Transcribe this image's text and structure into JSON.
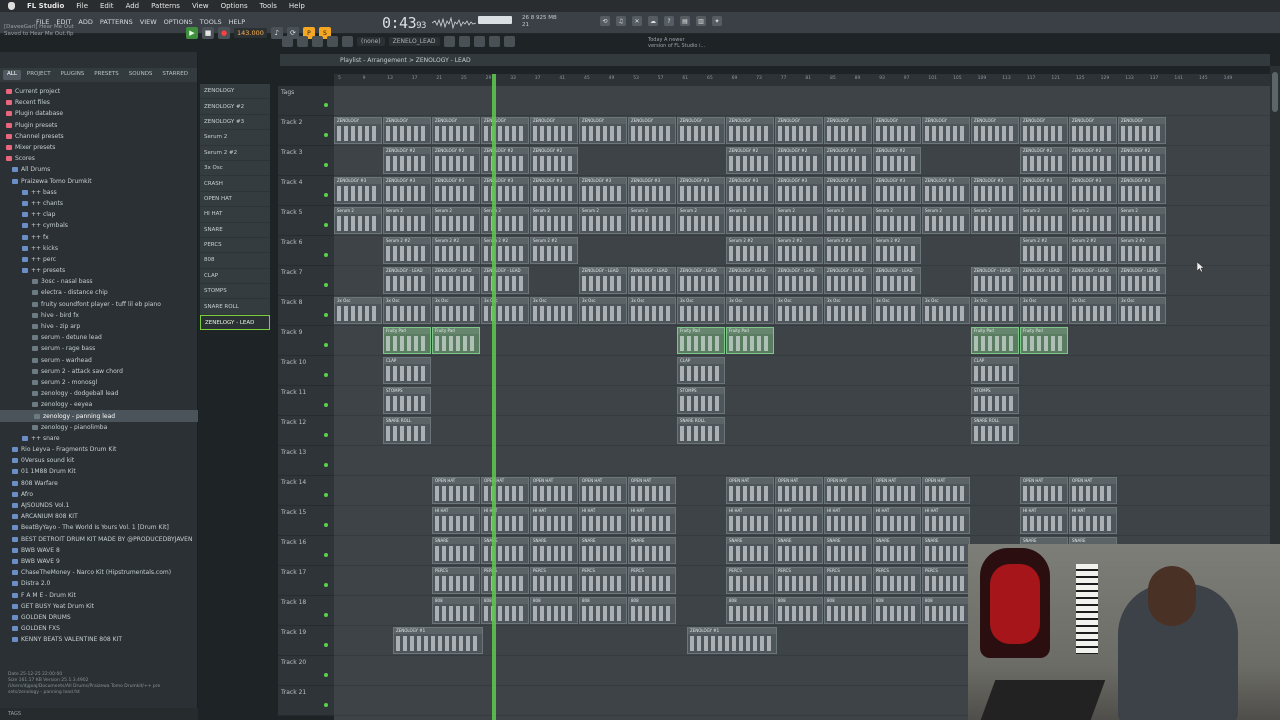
{
  "mac_menu": {
    "app": "FL Studio",
    "items": [
      "File",
      "Edit",
      "Add",
      "Patterns",
      "View",
      "Options",
      "Tools",
      "Help"
    ]
  },
  "fl_menu": [
    "FILE",
    "EDIT",
    "ADD",
    "PATTERNS",
    "VIEW",
    "OPTIONS",
    "TOOLS",
    "HELP"
  ],
  "song": {
    "line1": "[DaveeGarl] Hear Me Out",
    "line2": "Saved to Hear Me Out.flp"
  },
  "transport": {
    "bpm": "143.000",
    "time": "0:43",
    "time_small": "93",
    "cpu_line1": "26   8   925 MB",
    "cpu_line2": "      21"
  },
  "toolbar": {
    "snap": "(none)",
    "pattern": "ZENELO_LEAD"
  },
  "news": {
    "line1": "Today  A newer",
    "line2": "version of FL Studio i..."
  },
  "browser": {
    "tabs": [
      "ALL",
      "PROJECT",
      "PLUGINS",
      "PRESETS",
      "SOUNDS",
      "STARRED"
    ],
    "items": [
      {
        "label": "Current project",
        "kind": "cat"
      },
      {
        "label": "Recent files",
        "kind": "cat"
      },
      {
        "label": "Plugin database",
        "kind": "cat"
      },
      {
        "label": "Plugin presets",
        "kind": "cat"
      },
      {
        "label": "Channel presets",
        "kind": "cat"
      },
      {
        "label": "Mixer presets",
        "kind": "cat"
      },
      {
        "label": "Scores",
        "kind": "cat"
      },
      {
        "label": "All Drums",
        "kind": "folder"
      },
      {
        "label": "Praizewa Tomo Drumkit",
        "kind": "folder"
      },
      {
        "label": "++ bass",
        "kind": "sub"
      },
      {
        "label": "++ chants",
        "kind": "sub"
      },
      {
        "label": "++ clap",
        "kind": "sub"
      },
      {
        "label": "++ cymbals",
        "kind": "sub"
      },
      {
        "label": "++ fx",
        "kind": "sub"
      },
      {
        "label": "++ kicks",
        "kind": "sub"
      },
      {
        "label": "++ perc",
        "kind": "sub"
      },
      {
        "label": "++ presets",
        "kind": "sub"
      },
      {
        "label": "3osc - nasal bass",
        "kind": "file"
      },
      {
        "label": "electra - distance chip",
        "kind": "file"
      },
      {
        "label": "fruity soundfont player - tuff lil eb piano",
        "kind": "file"
      },
      {
        "label": "hive - bird fx",
        "kind": "file"
      },
      {
        "label": "hive - zip arp",
        "kind": "file"
      },
      {
        "label": "serum - detune lead",
        "kind": "file"
      },
      {
        "label": "serum - rage bass",
        "kind": "file"
      },
      {
        "label": "serum - warhead",
        "kind": "file"
      },
      {
        "label": "serum 2 - attack saw chord",
        "kind": "file"
      },
      {
        "label": "serum 2 - monosgl",
        "kind": "file"
      },
      {
        "label": "zenology - dodgeball lead",
        "kind": "file"
      },
      {
        "label": "zenology - eeyea",
        "kind": "file"
      },
      {
        "label": "zenology - panning lead",
        "kind": "selected"
      },
      {
        "label": "zenology - pianolimba",
        "kind": "file"
      },
      {
        "label": "++ snare",
        "kind": "sub"
      },
      {
        "label": "Rio Leyva - Fragments Drum Kit",
        "kind": "folder"
      },
      {
        "label": "0Versus sound kit",
        "kind": "folder"
      },
      {
        "label": "01 1M88 Drum Kit",
        "kind": "folder"
      },
      {
        "label": "808 Warfare",
        "kind": "folder"
      },
      {
        "label": "Afro",
        "kind": "folder"
      },
      {
        "label": "AJSOUNDS Vol.1",
        "kind": "folder"
      },
      {
        "label": "ARCANIUM 808 KIT",
        "kind": "folder"
      },
      {
        "label": "BeatByYayo - The World Is Yours Vol. 1 [Drum Kit]",
        "kind": "folder"
      },
      {
        "label": "BEST DETROIT DRUM KIT MADE BY @PRODUCEDBYJAVEN",
        "kind": "folder"
      },
      {
        "label": "BWB WAVE 8",
        "kind": "folder"
      },
      {
        "label": "BWB WAVE 9",
        "kind": "folder"
      },
      {
        "label": "ChaseTheMoney - Narco Kit (Hipstrumentals.com)",
        "kind": "folder"
      },
      {
        "label": "Distra 2.0",
        "kind": "folder"
      },
      {
        "label": "F A M E - Drum Kit",
        "kind": "folder"
      },
      {
        "label": "GET BUSY Yeat Drum Kit",
        "kind": "folder"
      },
      {
        "label": "GOLDEN DRUMS",
        "kind": "folder"
      },
      {
        "label": "GOLDEN FXS",
        "kind": "folder"
      },
      {
        "label": "KENNY BEATS VALENTINE 808 KIT",
        "kind": "folder"
      }
    ],
    "footer": {
      "line1": "Date  25-12-25 22:00:00",
      "line2": "Size  161.17 KB   Version 25.1.3.4902",
      "line3": "/Users/djgoaj/Documents/All Drums/Praizewa Tomo Drumkit/++ pre",
      "line4": "sets/zenology - panning lead.fst"
    },
    "tags_label": "TAGS"
  },
  "picker": [
    "ZENOLOGY",
    "ZENOLOGY #2",
    "ZENOLOGY #3",
    "Serum 2",
    "Serum 2 #2",
    "3x Osc",
    "CRASH",
    "OPEN HAT",
    "HI HAT",
    "SNARE",
    "PERCS",
    "808",
    "CLAP",
    "STOMPS",
    "SNARE ROLL",
    "ZENELOGY - LEAD"
  ],
  "playlist": {
    "title": "Playlist - Arrangement  >  ZENOLOGY - LEAD"
  },
  "ruler": [
    "5",
    "9",
    "13",
    "17",
    "21",
    "25",
    "29",
    "33",
    "37",
    "41",
    "45",
    "49",
    "53",
    "57",
    "61",
    "65",
    "69",
    "73",
    "77",
    "81",
    "85",
    "89",
    "93",
    "97",
    "101",
    "105",
    "109",
    "113",
    "117",
    "121",
    "125",
    "129",
    "133",
    "137",
    "141",
    "145",
    "149"
  ],
  "tracks": [
    "Tags",
    "Track 2",
    "Track 3",
    "Track 4",
    "Track 5",
    "Track 6",
    "Track 7",
    "Track 8",
    "Track 9",
    "Track 10",
    "Track 11",
    "Track 12",
    "Track 13",
    "Track 14",
    "Track 15",
    "Track 16",
    "Track 17",
    "Track 18",
    "Track 19",
    "Track 20",
    "Track 21"
  ],
  "clips": [
    {
      "track": 1,
      "label": "ZENOLOGY",
      "starts": [
        0,
        49,
        98,
        147,
        196,
        245,
        294,
        343,
        392,
        441,
        490,
        539,
        588,
        637,
        686,
        735,
        784
      ],
      "width": 48
    },
    {
      "track": 2,
      "label": "ZENOLOGY #2",
      "starts": [
        49,
        98,
        147,
        196,
        392,
        441,
        490,
        539,
        686,
        735,
        784
      ],
      "width": 48
    },
    {
      "track": 3,
      "label": "ZENOLOGY #3",
      "starts": [
        0,
        49,
        98,
        147,
        196,
        245,
        294,
        343,
        392,
        441,
        490,
        539,
        588,
        637,
        686,
        735,
        784
      ],
      "width": 48
    },
    {
      "track": 4,
      "label": "Serum 2",
      "starts": [
        0,
        49,
        98,
        147,
        196,
        245,
        294,
        343,
        392,
        441,
        490,
        539,
        588,
        637,
        686,
        735,
        784
      ],
      "width": 48
    },
    {
      "track": 5,
      "label": "Serum 2 #2",
      "starts": [
        49,
        98,
        147,
        196,
        392,
        441,
        490,
        539,
        686,
        735,
        784
      ],
      "width": 48
    },
    {
      "track": 6,
      "label": "ZENOLOGY - LEAD",
      "starts": [
        49,
        98,
        147,
        245,
        294,
        343,
        392,
        441,
        490,
        539,
        637,
        686,
        735,
        784
      ],
      "width": 48
    },
    {
      "track": 7,
      "label": "3x Osc",
      "starts": [
        0,
        49,
        98,
        147,
        196,
        245,
        294,
        343,
        392,
        441,
        490,
        539,
        588,
        637,
        686,
        735,
        784
      ],
      "width": 48
    },
    {
      "track": 8,
      "label": "Fruity Pad",
      "starts": [
        49,
        98,
        343,
        392,
        637,
        686
      ],
      "width": 48,
      "green": true
    },
    {
      "track": 9,
      "label": "CLAP",
      "starts": [
        49,
        343,
        637
      ],
      "width": 48
    },
    {
      "track": 10,
      "label": "STOMPS",
      "starts": [
        49,
        343,
        637
      ],
      "width": 48
    },
    {
      "track": 11,
      "label": "SNARE ROLL",
      "starts": [
        49,
        343,
        637
      ],
      "width": 48
    },
    {
      "track": 13,
      "label": "OPEN HAT",
      "starts": [
        98,
        147,
        196,
        245,
        294,
        392,
        441,
        490,
        539,
        588,
        686,
        735
      ],
      "width": 48
    },
    {
      "track": 14,
      "label": "HI HAT",
      "starts": [
        98,
        147,
        196,
        245,
        294,
        392,
        441,
        490,
        539,
        588,
        686,
        735
      ],
      "width": 48
    },
    {
      "track": 15,
      "label": "SNARE",
      "starts": [
        98,
        147,
        196,
        245,
        294,
        392,
        441,
        490,
        539,
        588,
        686,
        735
      ],
      "width": 48
    },
    {
      "track": 16,
      "label": "PERCS",
      "starts": [
        98,
        147,
        196,
        245,
        294,
        392,
        441,
        490,
        539,
        588,
        686,
        735
      ],
      "width": 48
    },
    {
      "track": 17,
      "label": "808",
      "starts": [
        98,
        147,
        196,
        245,
        294,
        392,
        441,
        490,
        539,
        588,
        686,
        735
      ],
      "width": 48
    },
    {
      "track": 18,
      "label": "ZENOLOGY #1",
      "starts": [
        59,
        353
      ],
      "width": 90
    }
  ]
}
